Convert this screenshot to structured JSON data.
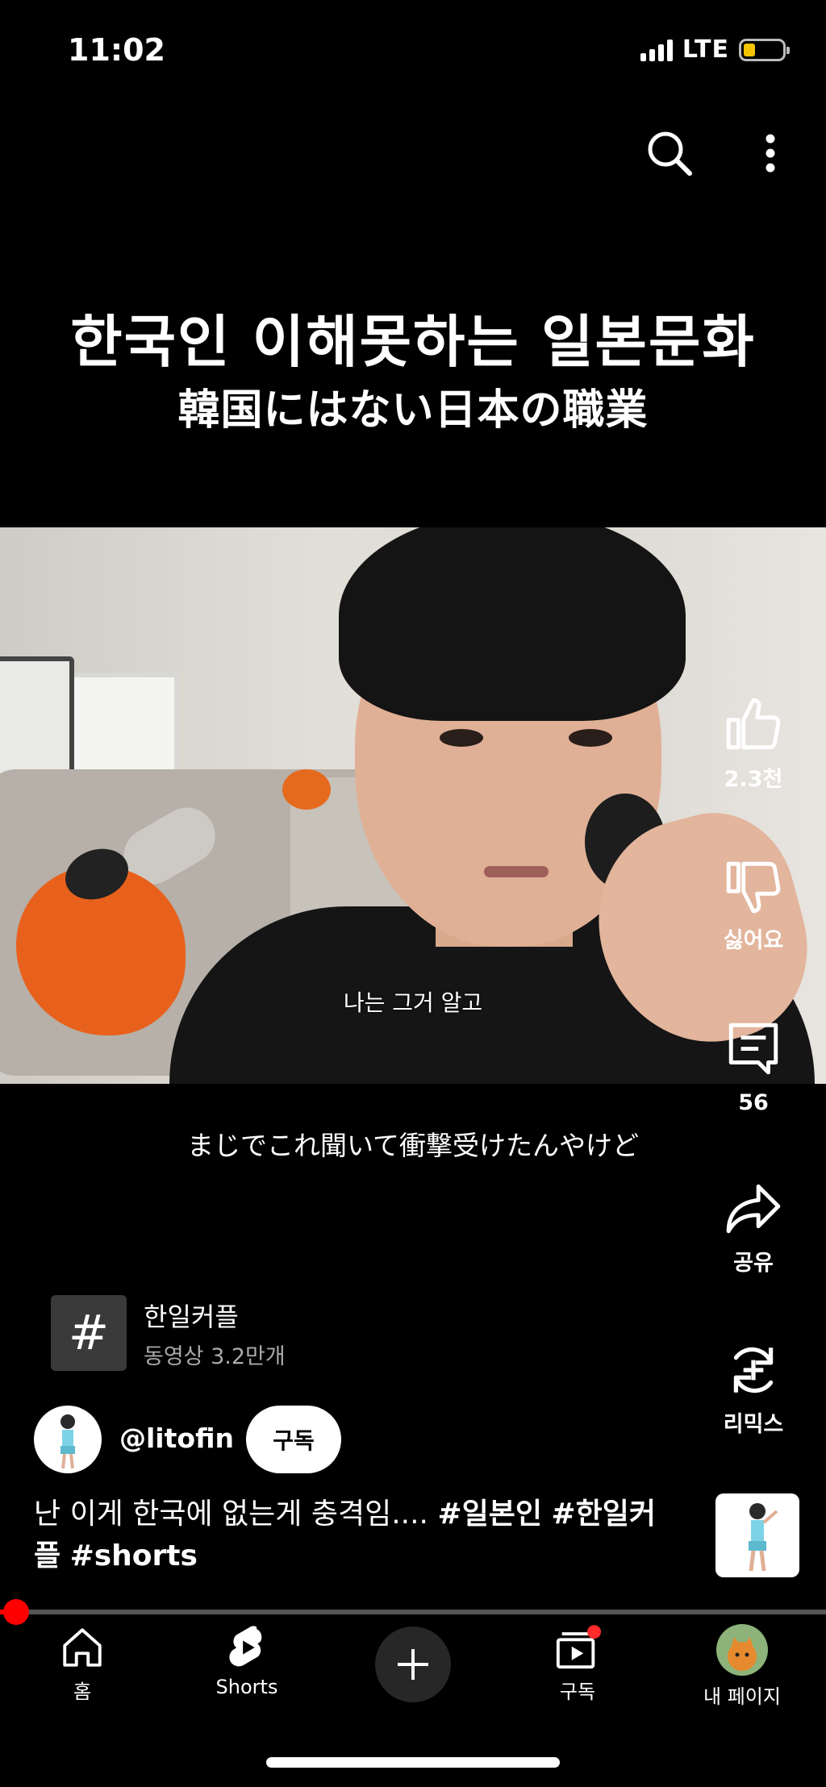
{
  "status": {
    "time": "11:02",
    "network": "LTE"
  },
  "header": {
    "search_icon": "search-icon",
    "more_icon": "more-vert-icon"
  },
  "video": {
    "title_ko": "한국인 이해못하는 일본문화",
    "title_ja": "韓国にはない日本の職業",
    "subtitle_ko": "나는 그거 알고",
    "subtitle_ja": "まじでこれ聞いて衝撃受けたんやけど",
    "progress_fraction": 0.02
  },
  "actions": {
    "like": "2.3천",
    "dislike": "싫어요",
    "comments": "56",
    "share": "공유",
    "remix": "리믹스"
  },
  "hashtag": {
    "name": "한일커플",
    "count": "동영상 3.2만개"
  },
  "channel": {
    "handle": "@litofin",
    "subscribe": "구독"
  },
  "description": {
    "text": "난 이게 한국에 없는게 충격임.... ",
    "tag1": "#일본인",
    "tag2": "#한일커플",
    "tag3": "#shorts"
  },
  "nav": {
    "home": "홈",
    "shorts": "Shorts",
    "subscriptions": "구독",
    "profile": "내 페이지"
  },
  "colors": {
    "accent": "#ff0000",
    "background": "#000000"
  }
}
